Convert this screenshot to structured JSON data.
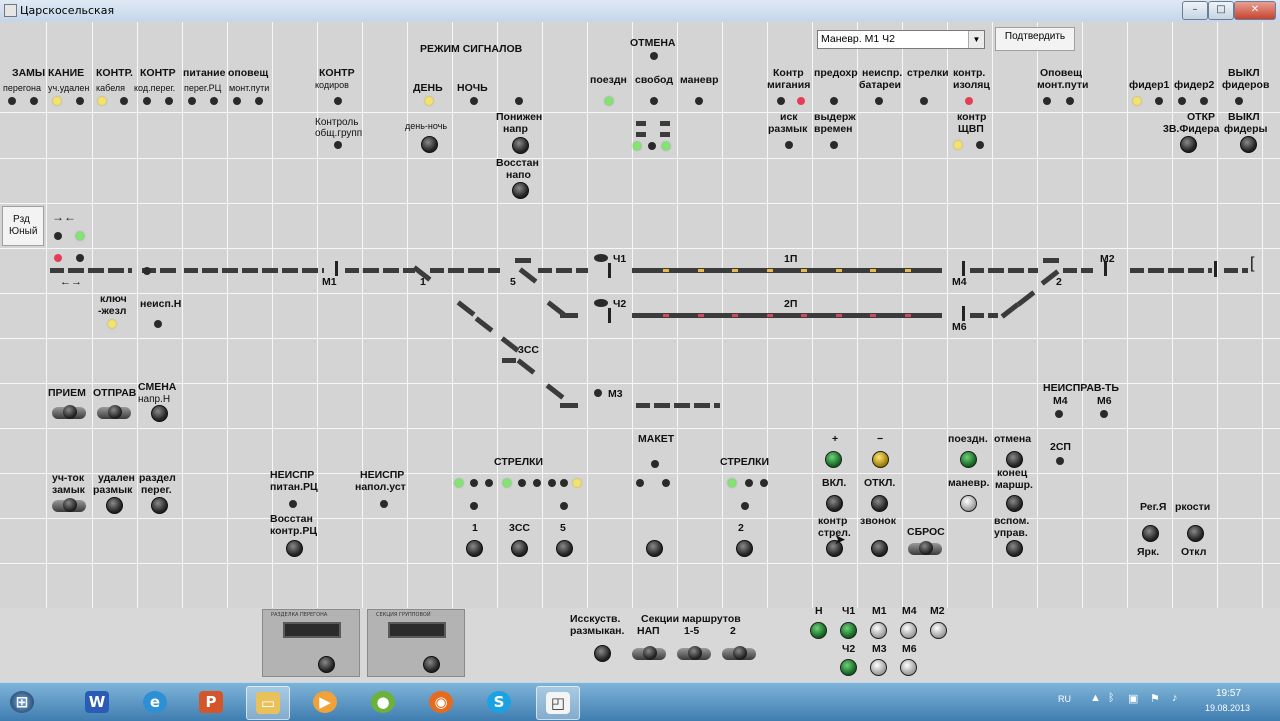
{
  "window": {
    "title": "Царскосельская"
  },
  "header": {
    "mode_label": "РЕЖИМ СИГНАЛОВ",
    "cancel_label": "ОТМЕНА",
    "select_value": "Маневр. М1 Ч2",
    "confirm_label": "Подтвердить"
  },
  "labels": {
    "zamy": "ЗАМЫ",
    "kanie": "КАНИЕ",
    "peregona": "перегона",
    "uch_udalen": "уч.удален",
    "kontr1": "КОНТР.",
    "kontr2": "КОНТР",
    "kabelya": "кабеля",
    "kod_pereg": "код.перег.",
    "pitanie": "питание",
    "opoveshch": "оповещ",
    "pereg_rc": "перег.РЦ",
    "mont_puti": "монт.пути",
    "kontr_kodirov_1": "КОНТР",
    "kontr_kodirov_2": "кодиров",
    "den": "ДЕНЬ",
    "noch": "НОЧЬ",
    "poezdn": "поездн",
    "svobod": "свобод",
    "manevr": "маневр",
    "kontr_migania_1": "Контр",
    "kontr_migania_2": "мигания",
    "predokhr": "предохр",
    "neispr_batarei_1": "неиспр.",
    "neispr_batarei_2": "батареи",
    "strelki_top": "стрелки",
    "kontr_izolyats_1": "контр.",
    "kontr_izolyats_2": "изоляц",
    "opoveshch_mont_1": "Оповещ",
    "opoveshch_mont_2": "монт.пути",
    "fider1": "фидер1",
    "fider2": "фидер2",
    "vykl_fiderov_1": "ВЫКЛ",
    "vykl_fiderov_2": "фидеров",
    "kontrol_obshch_1": "Контроль",
    "kontrol_obshch_2": "общ.групп",
    "den_noch": "день-ночь",
    "ponizhen_1": "Понижен",
    "ponizhen_2": "напр",
    "vosstan_1": "Восстан",
    "vosstan_2": "напо",
    "isk_razmyk_1": "иск",
    "isk_razmyk_2": "размык",
    "vyderzh_1": "выдерж",
    "vyderzh_2": "времен",
    "kontr_shchvp_1": "контр",
    "kontr_shchvp_2": "ЩВП",
    "otkr_1": "ОТКР",
    "otkr_2": "3В.Фидера",
    "vykl_fidery_1": "ВЫКЛ",
    "vykl_fidery_2": "фидеры",
    "rzd_1": "Рзд",
    "rzd_2": "Юный",
    "ch1": "Ч1",
    "ch2": "Ч2",
    "p1": "1П",
    "p2": "2П",
    "m1": "М1",
    "m2": "М2",
    "m3": "М3",
    "m4": "М4",
    "m6": "М6",
    "one": "1",
    "five": "5",
    "two": "2",
    "zss": "3СС",
    "klyuch_1": "ключ",
    "klyuch_2": "-жезл",
    "neisp_n": "неисп.Н",
    "priem": "ПРИЕМ",
    "otprav": "ОТПРАВ",
    "smena_1": "СМЕНА",
    "smena_2": "напр.Н",
    "neisprav_1": "НЕИСПРАВ-ТЬ",
    "neisprav_m4": "М4",
    "neisprav_m6": "М6",
    "sp2": "2СП",
    "maket": "МАКЕТ",
    "strelki_l": "СТРЕЛКИ",
    "strelki_r": "СТРЕЛКИ",
    "plus": "+",
    "minus": "−",
    "poezdn2": "поездн.",
    "otmena2": "отмена",
    "uch_tok_1": "уч-ток",
    "uch_tok_2": "замык",
    "udalen_1": "удален",
    "udalen_2": "размык",
    "razdel_1": "раздел",
    "razdel_2": "перег.",
    "neispr_pitan_1": "НЕИСПР",
    "neispr_pitan_2": "питан.РЦ",
    "neispr_napol_1": "НЕИСПР",
    "neispr_napol_2": "напол.уст",
    "vosstan_kontr_1": "Восстан",
    "vosstan_kontr_2": "контр.РЦ",
    "vkl": "ВКЛ.",
    "otkl": "ОТКЛ.",
    "manevr2": "маневр.",
    "konets_1": "конец",
    "konets_2": "маршр.",
    "kontr_strel_1": "контр",
    "kontr_strel_2": "стрел.",
    "zvonok": "звонок",
    "sbros": "СБРОС",
    "vspom_1": "вспом.",
    "vspom_2": "управ.",
    "reg_ya": "Рег.Я",
    "rkosti": "ркости",
    "yark": "Ярк.",
    "otkl2": "Откл",
    "btm_1": "1",
    "btm_zss": "3СС",
    "btm_5": "5",
    "btm_2": "2"
  },
  "bottom": {
    "device1_caption": "РАЗДЕЛКА ПЕРЕГОНА",
    "device2_caption": "СЕКЦИЯ ГРУППОВОЙ",
    "isk_1": "Исскуств.",
    "isk_2": "размыкан.",
    "sekcii": "Секции маршрутов",
    "nap": "НАП",
    "r15": "1-5",
    "r2": "2",
    "lamps": [
      "Н",
      "Ч1",
      "М1",
      "М4",
      "М2",
      "Ч2",
      "М3",
      "М6"
    ]
  },
  "taskbar": {
    "lang": "RU",
    "time": "19:57",
    "date": "19.08.2013"
  },
  "colors": {
    "panel": "#d4d4d4",
    "yellow": "#f3e26b",
    "green": "#84e470",
    "red": "#e53d55",
    "track": "#3b3b3b"
  }
}
